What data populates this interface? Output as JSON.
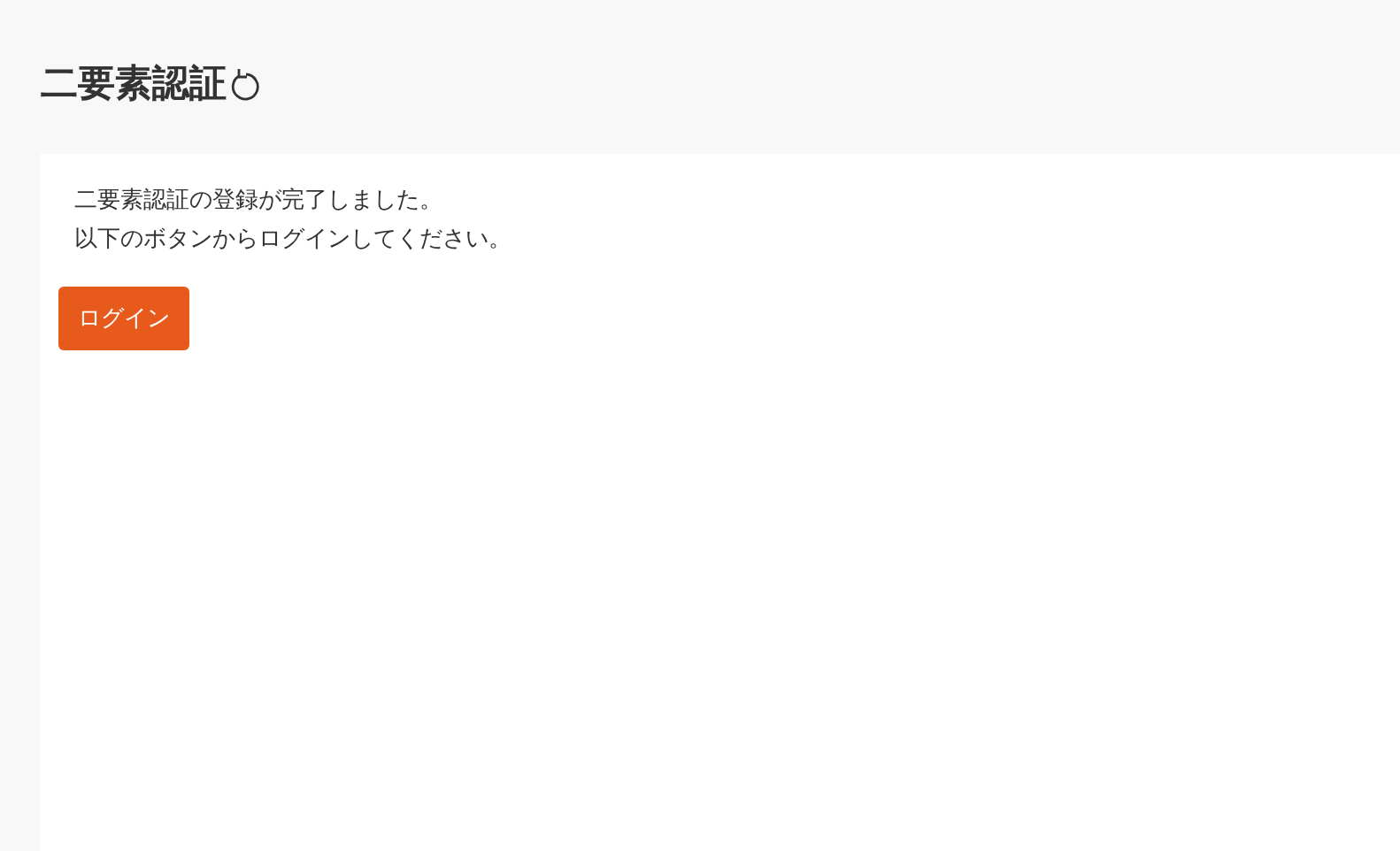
{
  "page": {
    "title": "二要素認証"
  },
  "message": {
    "lines": [
      "二要素認証の登録が完了しました。",
      "以下のボタンからログインしてください。"
    ]
  },
  "button": {
    "label": "ログイン"
  }
}
